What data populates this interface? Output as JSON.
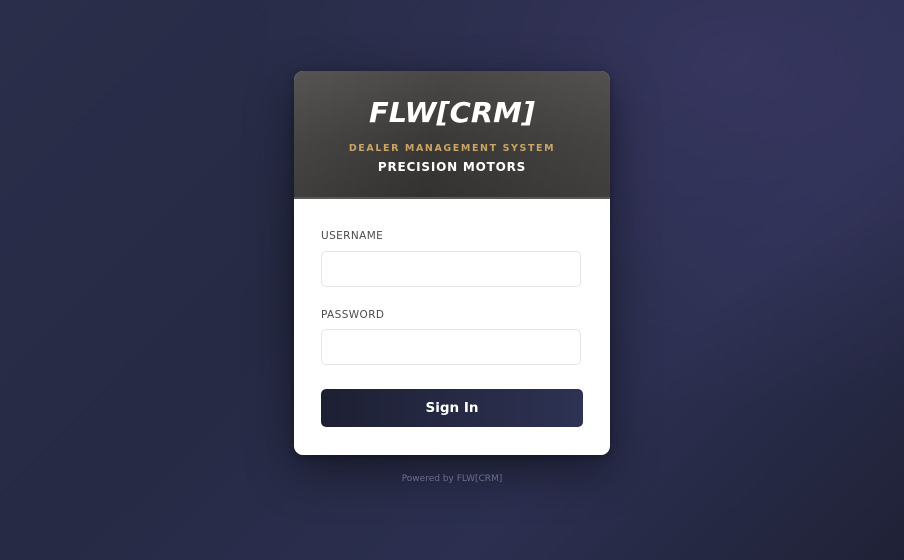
{
  "brand": {
    "logo_text": "FLW[CRM]",
    "subtitle": "DEALER MANAGEMENT SYSTEM",
    "dealer_name": "PRECISION MOTORS"
  },
  "form": {
    "username_label": "USERNAME",
    "username_value": "",
    "password_label": "PASSWORD",
    "password_value": "",
    "submit_label": "Sign In"
  },
  "footer": {
    "powered_by": "Powered by FLW[CRM]"
  },
  "colors": {
    "accent_gold": "#c9a464",
    "button_dark": "#1d2033",
    "background": "#2a2e4a"
  }
}
